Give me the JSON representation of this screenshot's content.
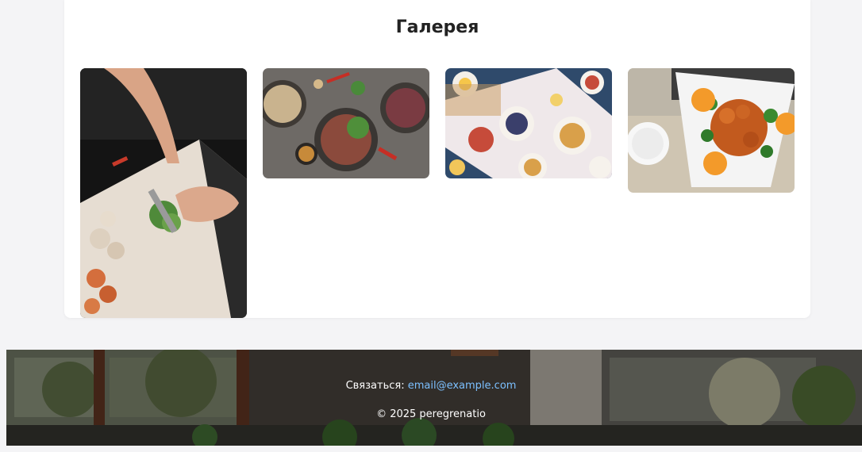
{
  "gallery": {
    "title": "Галерея",
    "images": [
      {
        "icon": "chef-cutting-photo"
      },
      {
        "icon": "steak-bowls-photo"
      },
      {
        "icon": "breakfast-table-photo"
      },
      {
        "icon": "orange-chicken-photo"
      }
    ]
  },
  "footer": {
    "contact_label": "Связаться:",
    "email": "email@example.com",
    "copyright": "© 2025 peregrenatio",
    "link_color": "#7cc0ff"
  }
}
